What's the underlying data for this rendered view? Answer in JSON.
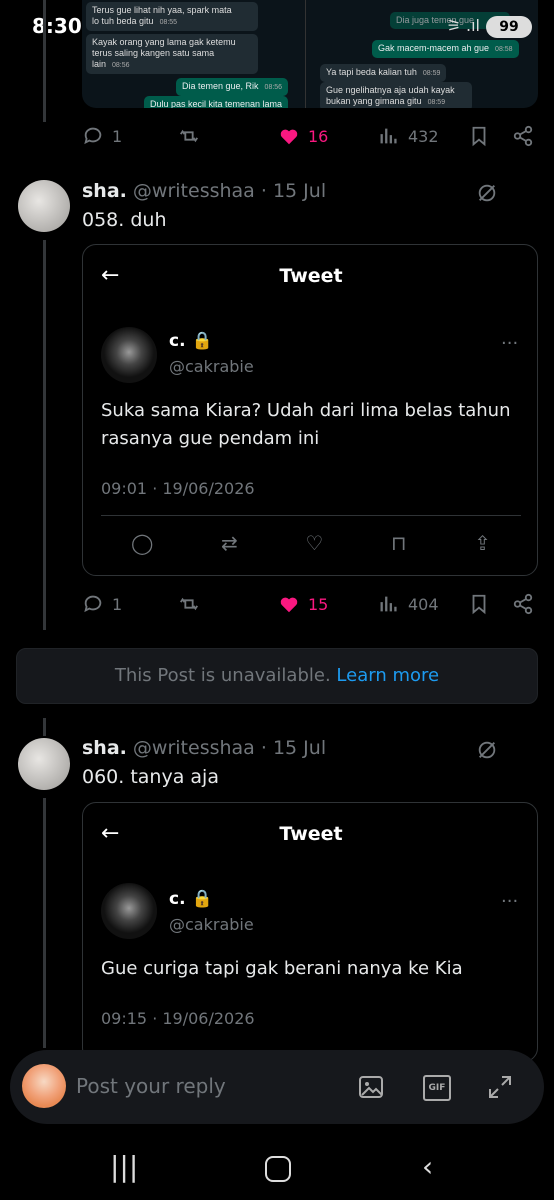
{
  "status": {
    "time": "8:30",
    "battery": "99"
  },
  "chat": {
    "left": [
      {
        "text": "Terus gue lihat nih yaa, spark mata\nlo tuh beda gitu",
        "time": "08:55"
      },
      {
        "text": "Kayak orang yang lama gak ketemu\nterus saling kangen satu sama lain",
        "time": "08:56"
      }
    ],
    "left_out": [
      {
        "text": "Dia temen gue, Rik",
        "time": "08:56"
      },
      {
        "text": "Dulu pas kecil kita temenan lama",
        "time": ""
      }
    ],
    "right": [
      {
        "text": "Dia juga temen gue",
        "time": ""
      },
      {
        "text": "Gak macem-macem ah gue",
        "time": "08:58"
      }
    ],
    "right_in": [
      {
        "text": "Ya tapi beda kalian tuh",
        "time": "08:59"
      },
      {
        "text": "Gue ngelihatnya aja udah kayak\nbukan yang gimana gitu",
        "time": "08:59"
      }
    ]
  },
  "post0": {
    "replies": "1",
    "likes": "16",
    "views": "432"
  },
  "post1": {
    "name": "sha.",
    "handle": "@writesshaa",
    "date": "· 15 Jul",
    "text": "058. duh",
    "quote": {
      "header": "Tweet",
      "name": "c.",
      "handle": "@cakrabie",
      "text": "Suka sama Kiara? Udah dari lima belas tahun rasanya gue pendam ini",
      "time": "09:01 · 19/06/2026"
    },
    "replies": "1",
    "likes": "15",
    "views": "404"
  },
  "unavailable": {
    "text": "This Post is unavailable.",
    "link": "Learn more"
  },
  "post2": {
    "name": "sha.",
    "handle": "@writesshaa",
    "date": "· 15 Jul",
    "text": "060. tanya aja",
    "quote": {
      "header": "Tweet",
      "name": "c.",
      "handle": "@cakrabie",
      "text": "Gue curiga tapi gak berani nanya ke Kia",
      "time": "09:15 · 19/06/2026"
    }
  },
  "reply": {
    "placeholder": "Post your reply"
  },
  "icons": [
    "reply-icon",
    "retweet-icon",
    "like-icon",
    "views-icon",
    "bookmark-icon",
    "share-icon",
    "grok-icon",
    "back-arrow-icon",
    "lock-icon",
    "more-icon",
    "image-icon",
    "gif-icon",
    "expand-icon"
  ],
  "colors": {
    "like": "#f91880",
    "link": "#1d9bf0",
    "muted": "#71767b"
  }
}
